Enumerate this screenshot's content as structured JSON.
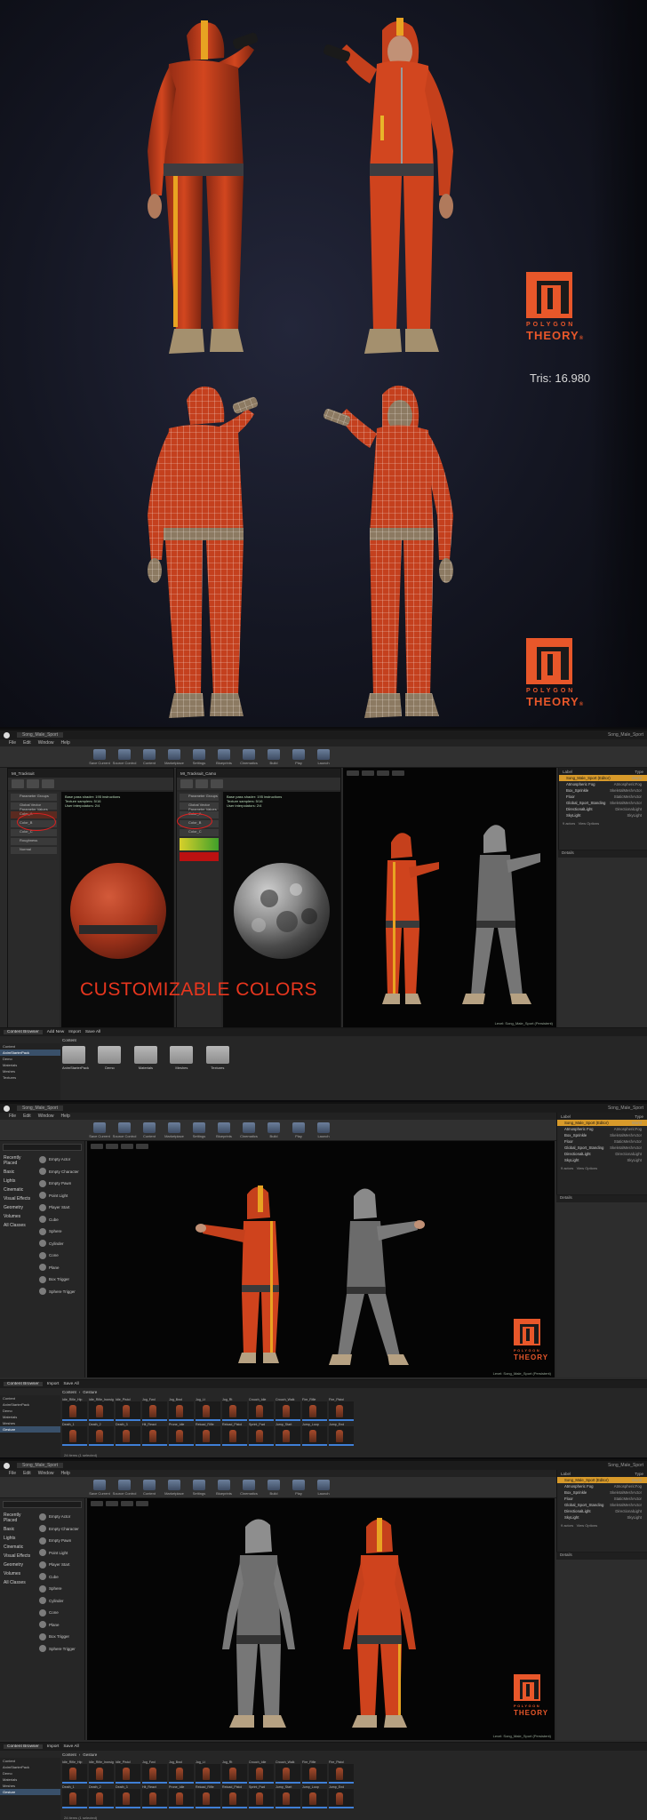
{
  "renders": {
    "tris_label": "Tris: 16.980",
    "brand_line1": "POLYGON",
    "brand_line2": "THEORY",
    "brand_reg": "®"
  },
  "editor": {
    "menu": [
      "File",
      "Edit",
      "Window",
      "Help"
    ],
    "toolbar": [
      "Save Current",
      "Source Control",
      "Content",
      "Marketplace",
      "Settings",
      "Blueprints",
      "Cinematics",
      "Build",
      "Play",
      "Launch"
    ],
    "level_label": "Level: Song_Male_Sport (Persistent)",
    "outliner_header": {
      "label": "Label",
      "type": "Type"
    },
    "outliner_rows": [
      {
        "label": "Song_Male_Sport (Editor)",
        "type": "World"
      },
      {
        "label": "Atmospheric Fog",
        "type": "AtmosphericFog"
      },
      {
        "label": "Box_Sprinkle",
        "type": "SkeletalMeshActor"
      },
      {
        "label": "Floor",
        "type": "StaticMeshActor"
      },
      {
        "label": "Global_Sport_Standing",
        "type": "SkeletalMeshActor"
      },
      {
        "label": "DirectionalLight",
        "type": "DirectionalLight"
      },
      {
        "label": "SkyLight",
        "type": "SkyLight"
      },
      {
        "label": "Sky Sphere",
        "type": "Edit BP_Sky_Sphere"
      },
      {
        "label": "SkyLight",
        "type": "SkyLight"
      }
    ],
    "outliner_footer": "9 actors",
    "view_options": "View Options",
    "details_header": "Details",
    "modes_categories": [
      "Recently Placed",
      "Basic",
      "Lights",
      "Cinematic",
      "Visual Effects",
      "Geometry",
      "Volumes",
      "All Classes"
    ],
    "modes_items": [
      "Empty Actor",
      "Empty Character",
      "Empty Pawn",
      "Point Light",
      "Player Start",
      "Cube",
      "Sphere",
      "Cylinder",
      "Cone",
      "Plane",
      "Box Trigger",
      "Sphere Trigger"
    ],
    "content_browser": {
      "tab": "Content Browser",
      "add_new": "Add New",
      "import": "Import",
      "save_all": "Save All",
      "path_root": "Content",
      "path_child": "Gesture",
      "folders": [
        "AnimStarterPack",
        "Demo",
        "Materials",
        "Meshes",
        "Textures"
      ],
      "tree": [
        "Content",
        "AnimStarterPack",
        "Demo",
        "Materials",
        "Meshes",
        "Textures",
        "Gesture"
      ],
      "anim_labels": [
        "Idle_Rifle_Hip",
        "Idle_Rifle_Ironsights",
        "Idle_Pistol",
        "Jog_Fwd",
        "Jog_Bwd",
        "Jog_Lt",
        "Jog_Rt",
        "Crouch_Idle",
        "Crouch_Walk",
        "Fire_Rifle",
        "Fire_Pistol",
        "Death_1",
        "Death_2",
        "Death_3",
        "Hit_React",
        "Prone_Idle",
        "Reload_Rifle",
        "Reload_Pistol",
        "Sprint_Fwd",
        "Jump_Start",
        "Jump_Loop",
        "Jump_End"
      ],
      "item_count": "24 items (1 selected)"
    },
    "material_editor": {
      "stats": "Base pass shader: 195 instructions\nTexture samplers: 5/16\nUser interpolators: 2/4",
      "params": [
        "Parameter Groups",
        "Global Vector Parameter Values",
        "Color_A",
        "Color_B",
        "Color_C",
        "Roughness",
        "Normal"
      ]
    },
    "customizable_colors": "CUSTOMIZABLE COLORS"
  }
}
